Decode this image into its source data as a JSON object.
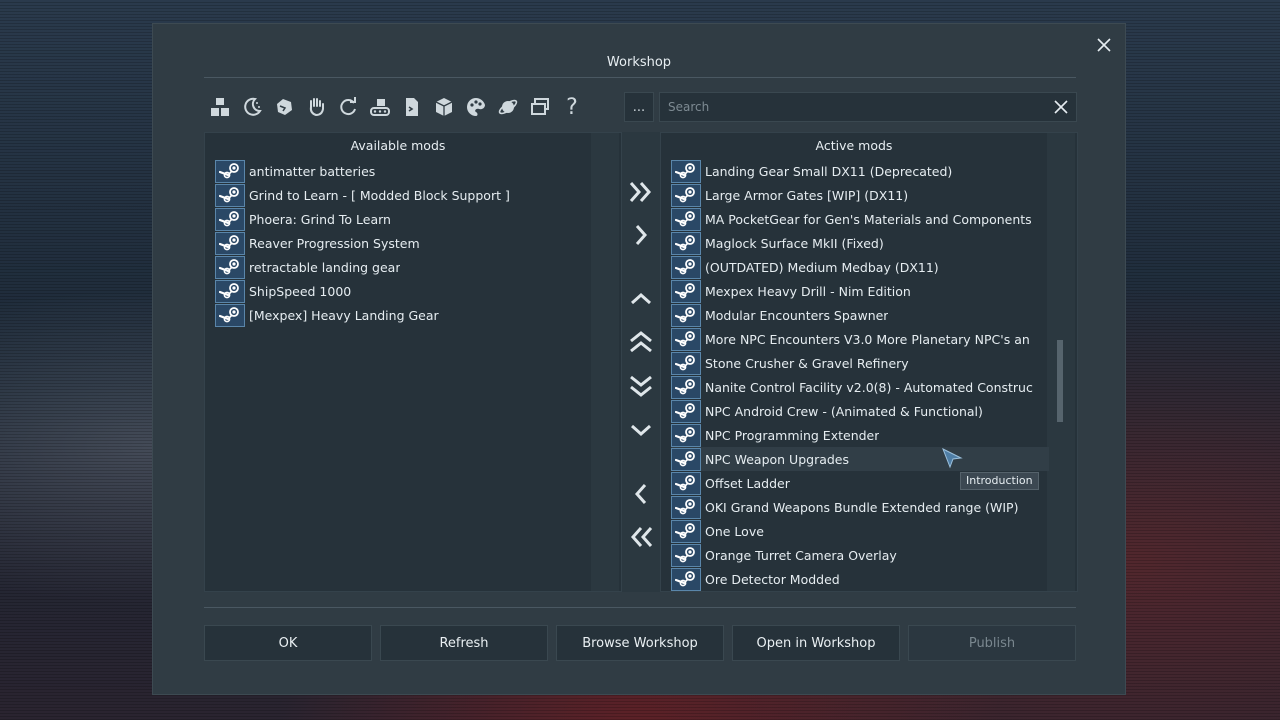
{
  "dialog": {
    "title": "Workshop"
  },
  "toolbar": {
    "icons": [
      "blocks-icon",
      "moon-icon",
      "asteroid-icon",
      "hand-icon",
      "refresh-icon",
      "conveyor-icon",
      "script-icon",
      "crate-icon",
      "palette-icon",
      "planet-icon",
      "windows-icon",
      "help-icon"
    ],
    "help_label": "?",
    "more_label": "..."
  },
  "search": {
    "placeholder": "Search",
    "value": ""
  },
  "available": {
    "header": "Available mods",
    "items": [
      "antimatter batteries",
      "Grind to Learn - [ Modded Block Support ]",
      "Phoera: Grind To Learn",
      "Reaver Progression System",
      "retractable landing gear",
      "ShipSpeed 1000",
      "[Mexpex] Heavy Landing Gear"
    ]
  },
  "active": {
    "header": "Active mods",
    "items": [
      "Landing Gear Small DX11 (Deprecated)",
      "Large Armor Gates [WIP] (DX11)",
      "MA PocketGear for Gen's Materials and Components",
      "Maglock Surface MkII (Fixed)",
      "(OUTDATED) Medium Medbay (DX11)",
      "Mexpex Heavy Drill - Nim Edition",
      "Modular Encounters Spawner",
      "More NPC Encounters V3.0 More Planetary NPC's an",
      "Stone Crusher & Gravel Refinery",
      "Nanite Control Facility v2.0(8) - Automated Construc",
      "NPC Android Crew - (Animated & Functional)",
      "NPC Programming Extender",
      "NPC Weapon Upgrades",
      "Offset Ladder",
      "OKI Grand Weapons Bundle Extended range (WIP)",
      "One Love",
      "Orange Turret  Camera Overlay",
      "Ore Detector Modded"
    ],
    "highlighted_index": 12
  },
  "tooltip": {
    "text": "Introduction"
  },
  "buttons": {
    "ok": "OK",
    "refresh": "Refresh",
    "browse": "Browse Workshop",
    "open": "Open in Workshop",
    "publish": "Publish"
  },
  "colors": {
    "dialog_bg": "#303c44",
    "panel_bg": "#26323a",
    "steam_icon_bg": "#2a4866",
    "text": "#e6edf1",
    "disabled_text": "#7a878f"
  }
}
